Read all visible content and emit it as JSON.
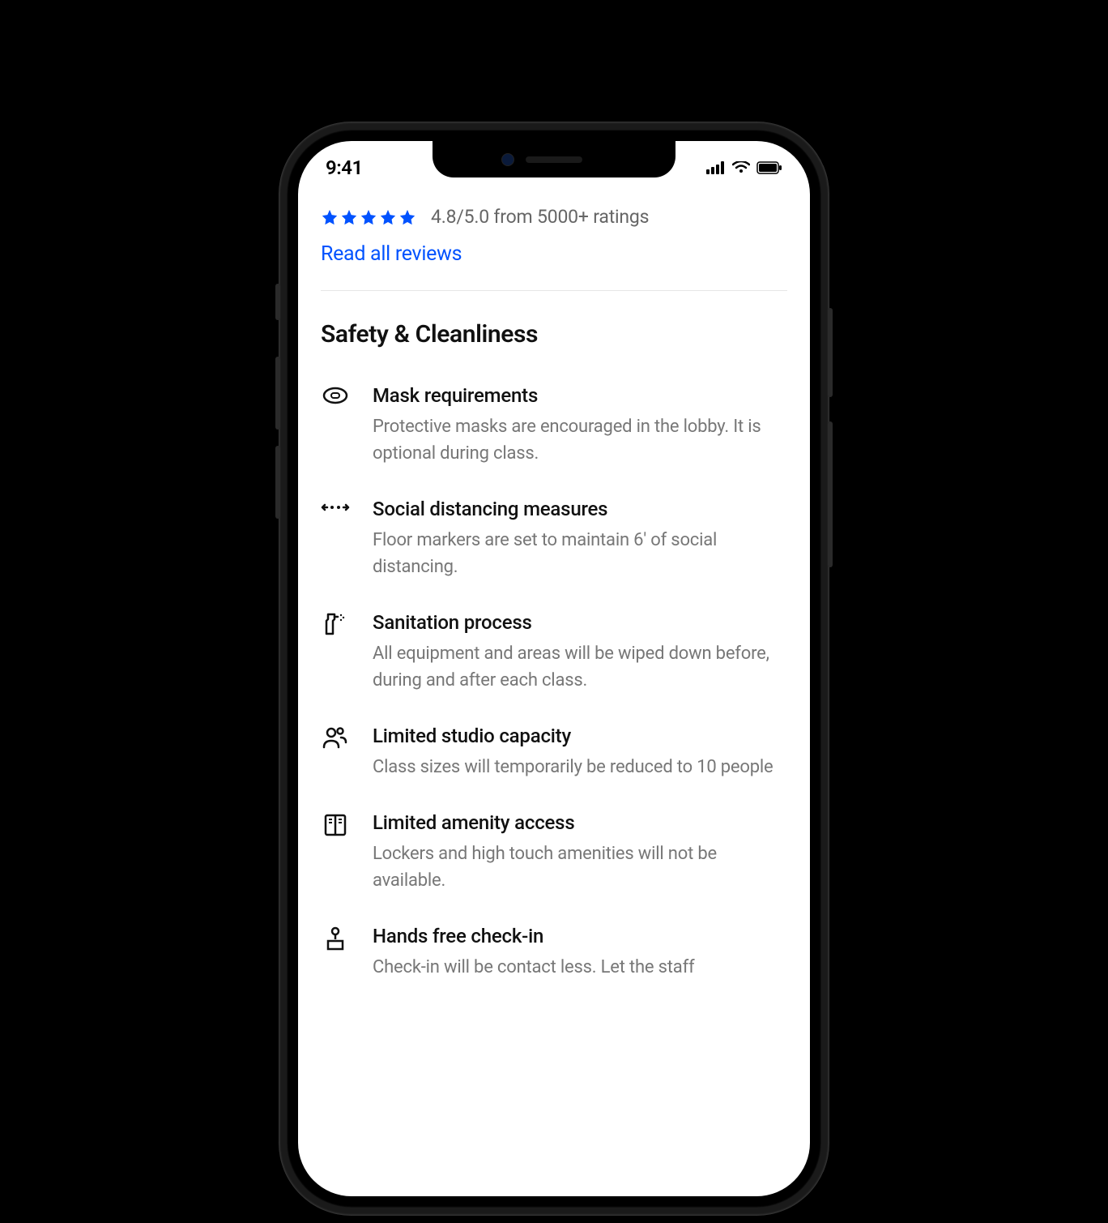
{
  "status": {
    "time": "9:41"
  },
  "rating": {
    "text": "4.8/5.0 from 5000+ ratings",
    "reviews_link": "Read all reviews"
  },
  "section": {
    "title": "Safety & Cleanliness"
  },
  "items": [
    {
      "title": "Mask requirements",
      "desc": "Protective masks are encouraged in the lobby. It is optional during class."
    },
    {
      "title": "Social distancing measures",
      "desc": "Floor markers are set to maintain 6' of social distancing."
    },
    {
      "title": "Sanitation process",
      "desc": "All equipment and areas will be wiped down before, during and after each class."
    },
    {
      "title": "Limited studio capacity",
      "desc": "Class sizes will temporarily be reduced to 10 people"
    },
    {
      "title": "Limited amenity access",
      "desc": "Lockers and high touch amenities will not be available."
    },
    {
      "title": "Hands free check-in",
      "desc": "Check-in will be contact less. Let the staff"
    }
  ]
}
